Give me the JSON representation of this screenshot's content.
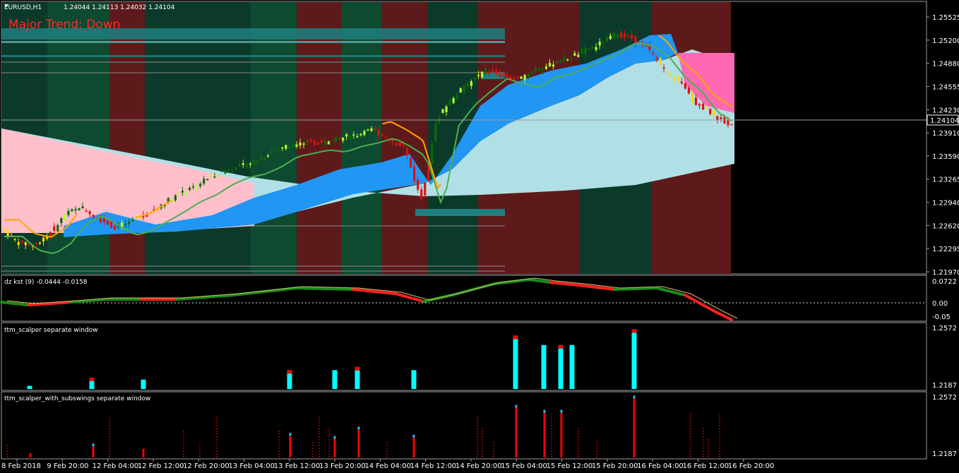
{
  "main": {
    "symbol_title": "EURUSD,H1",
    "ohlc": "1.24044 1.24113 1.24032 1.24104",
    "trend_label": "Major Trend: Down",
    "current_price_label": "1.24104",
    "price_ticks": [
      "1.25525",
      "1.25200",
      "1.24880",
      "1.24555",
      "1.24230",
      "1.23910",
      "1.23590",
      "1.23265",
      "1.22940",
      "1.22620",
      "1.22295",
      "1.21970"
    ]
  },
  "kst": {
    "title": "dz kst (9) -0.0444 -0.0158",
    "ticks": [
      "0.0722",
      "0.00",
      "-0.05"
    ]
  },
  "scalper": {
    "title": "ttm_scalper separate window",
    "ticks": [
      "1.2572",
      "1.2187"
    ]
  },
  "subswings": {
    "title": "ttm_scalper_with_subswings separate window",
    "ticks": [
      "1.2572",
      "1.2187"
    ]
  },
  "time_axis": {
    "labels": [
      "8 Feb 2018",
      "9 Feb 20:00",
      "12 Feb 04:00",
      "12 Feb 12:00",
      "12 Feb 20:00",
      "13 Feb 04:00",
      "13 Feb 12:00",
      "13 Feb 20:00",
      "14 Feb 04:00",
      "14 Feb 12:00",
      "14 Feb 20:00",
      "15 Feb 04:00",
      "15 Feb 12:00",
      "15 Feb 20:00",
      "16 Feb 04:00",
      "16 Feb 12:00",
      "16 Feb 20:00"
    ]
  },
  "colors": {
    "background": "#000000",
    "zone_red": "#5e1a1a",
    "zone_green": "#0b3a2a",
    "zone_green_dark": "#0d4a30",
    "cloud_blue": "#2196f3",
    "cloud_light": "#b0e0e6",
    "cloud_pink": "#ffc0cb",
    "candle_bull": "#0a6b0a",
    "candle_bull_bright": "#adff2f",
    "candle_bear": "#e01010",
    "candle_yellow": "#ffd700",
    "ma_green": "#4caf50",
    "ma_orange": "#ffa500",
    "kst_green": "#1b8a1b",
    "kst_red": "#ff2020",
    "bar_cyan": "#00ffff",
    "bar_red": "#ff0000"
  },
  "chart_data": {
    "type": "candlestick",
    "symbol": "EURUSD",
    "timeframe": "H1",
    "ylim": [
      1.2197,
      1.2565
    ],
    "current_price": 1.24104,
    "trend_state": "Down",
    "close_path": [
      1.226,
      1.224,
      1.2235,
      1.225,
      1.228,
      1.229,
      1.2275,
      1.2262,
      1.2268,
      1.2282,
      1.2295,
      1.231,
      1.232,
      1.2335,
      1.2345,
      1.235,
      1.236,
      1.2375,
      1.238,
      1.2385,
      1.2382,
      1.239,
      1.2395,
      1.2402,
      1.239,
      1.2375,
      1.23,
      1.242,
      1.245,
      1.247,
      1.2488,
      1.248,
      1.2475,
      1.249,
      1.2495,
      1.2505,
      1.2515,
      1.2525,
      1.254,
      1.2535,
      1.252,
      1.249,
      1.247,
      1.244,
      1.2425,
      1.241
    ],
    "series": [
      {
        "name": "dz kst (9)",
        "values": [
          -0.0444,
          -0.0158
        ]
      }
    ],
    "scalper_bars": [
      0.05,
      0.18,
      0.15,
      0.3,
      0.3,
      0.35,
      0.3,
      0.85,
      0.7,
      0.7,
      0.7,
      0.95
    ],
    "subswing_bars": [
      0.07,
      0.18,
      0.14,
      0.35,
      0.3,
      0.45,
      0.32,
      0.8,
      0.72,
      0.72,
      0.95
    ]
  }
}
